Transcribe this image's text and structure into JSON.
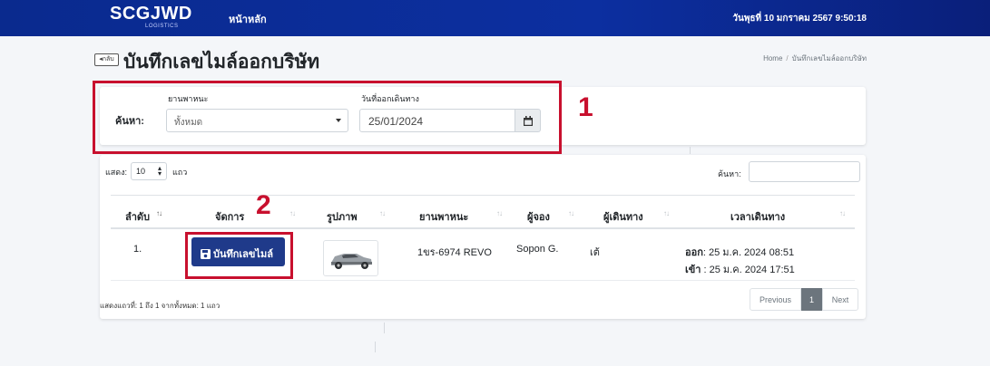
{
  "navbar": {
    "logo": "SCGJWD",
    "logo_sub": "LOGISTICS",
    "home": "หน้าหลัก",
    "datetime": "วันพุธที่ 10 มกราคม 2567  9:50:18"
  },
  "page": {
    "back_label": "◂กลับ",
    "title": "บันทึกเลขไมล์ออกบริษัท",
    "breadcrumb": [
      "Home",
      "บันทึกเลขไมล์ออกบริษัท"
    ]
  },
  "search": {
    "label": "ค้นหา:",
    "vehicle_label": "ยานพาหนะ",
    "vehicle_value": "ทั้งหมด",
    "date_label": "วันที่ออกเดินทาง",
    "date_value": "25/01/2024"
  },
  "table": {
    "length_label": "แสดง:",
    "length_value": "10",
    "length_suffix": "แถว",
    "filter_label": "ค้นหา:",
    "columns": [
      "ลำดับ",
      "จัดการ",
      "รูปภาพ",
      "ยานพาหนะ",
      "ผู้จอง",
      "ผู้เดินทาง",
      "เวลาเดินทาง"
    ],
    "rows": [
      {
        "no": "1.",
        "action": "บันทึกเลขไมล์",
        "vehicle": "1ขร-6974 REVO",
        "booker": "Sopon G.",
        "traveler": "เต้",
        "out_label": "ออก",
        "out_time": ": 25 ม.ค. 2024 08:51",
        "in_label": "เข้า",
        "in_time": " : 25 ม.ค. 2024 17:51"
      }
    ],
    "info": "แสดงแถวที่: 1 ถึง 1 จากทั้งหมด: 1 แถว",
    "pagination": {
      "prev": "Previous",
      "current": "1",
      "next": "Next"
    }
  },
  "annotations": {
    "marker_1": "1",
    "marker_2": "2"
  },
  "colors": {
    "navbar": "#0c2fa0",
    "button": "#1f3a8a",
    "highlight": "#c8102e"
  }
}
